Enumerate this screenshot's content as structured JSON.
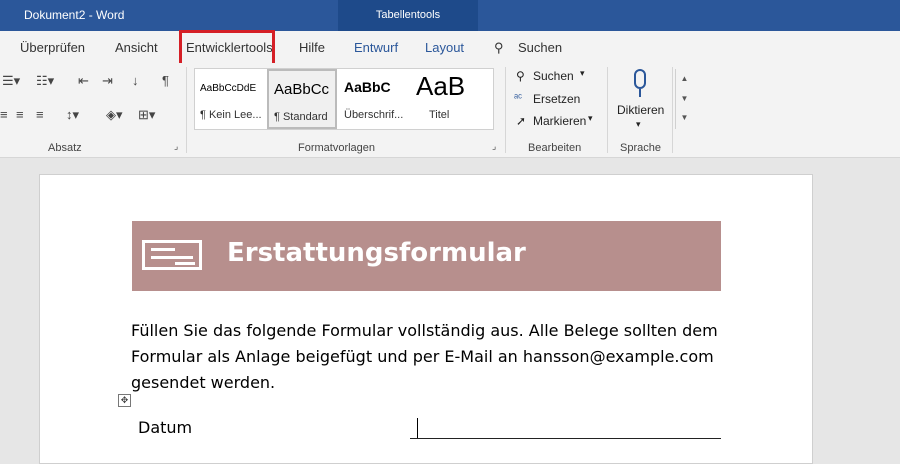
{
  "titlebar": {
    "document": "Dokument2 - Word",
    "context_tab": "Tabellentools"
  },
  "tabs": [
    {
      "label": "Überprüfen"
    },
    {
      "label": "Ansicht"
    },
    {
      "label": "Entwicklertools"
    },
    {
      "label": "Hilfe"
    },
    {
      "label": "Entwurf"
    },
    {
      "label": "Layout"
    }
  ],
  "search": {
    "label": "Suchen"
  },
  "ribbon": {
    "groups": {
      "absatz": "Absatz",
      "formatvorlagen": "Formatvorlagen",
      "bearbeiten": "Bearbeiten",
      "sprache": "Sprache"
    },
    "styles": [
      {
        "sample": "AaBbCcDdE",
        "name": "¶ Kein Lee..."
      },
      {
        "sample": "AaBbCc",
        "name": "¶ Standard"
      },
      {
        "sample": "AaBbC",
        "name": "Überschrif..."
      },
      {
        "sample": "AaB",
        "name": "Titel"
      }
    ],
    "editing": {
      "find": "Suchen",
      "replace": "Ersetzen",
      "select": "Markieren"
    },
    "dictate": "Diktieren"
  },
  "document": {
    "banner_title": "Erstattungsformular",
    "paragraph": "Füllen Sie das folgende Formular vollständig aus.  Alle Belege sollten dem Formular als Anlage beigefügt und per E-Mail an hansson@example.com gesendet werden.",
    "date_label": "Datum"
  },
  "colors": {
    "titlebar": "#2b579a",
    "banner": "#b78f8d",
    "highlight": "#d51f26"
  }
}
